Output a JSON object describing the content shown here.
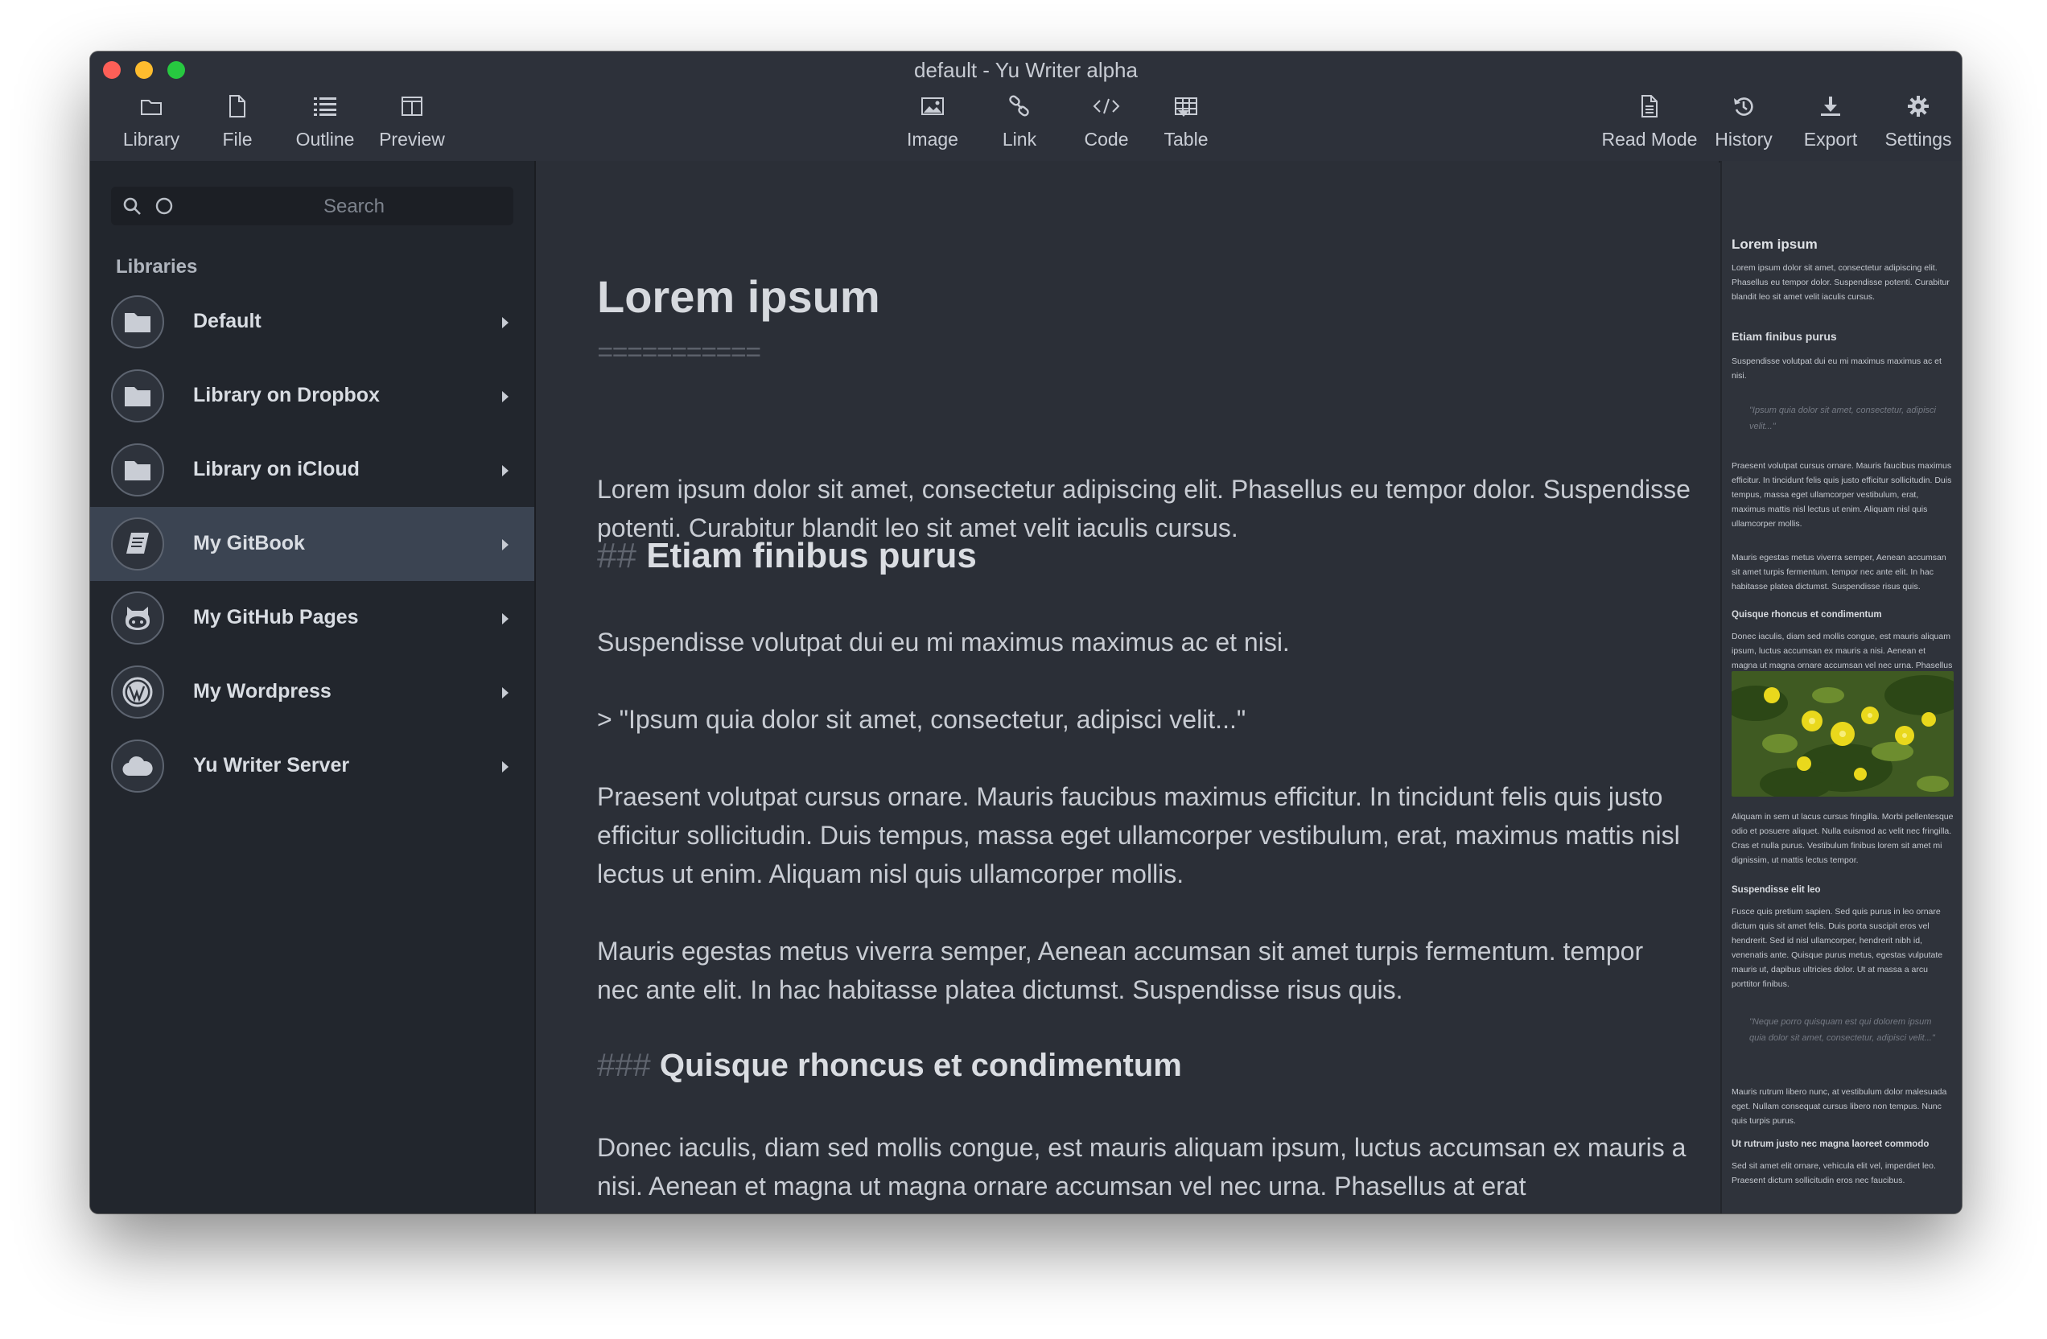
{
  "window": {
    "title": "default - Yu Writer alpha"
  },
  "toolbar": {
    "library": "Library",
    "file": "File",
    "outline": "Outline",
    "preview": "Preview",
    "image": "Image",
    "link": "Link",
    "code": "Code",
    "table": "Table",
    "read_mode": "Read Mode",
    "history": "History",
    "export": "Export",
    "settings": "Settings"
  },
  "sidebar": {
    "search_placeholder": "Search",
    "heading": "Libraries",
    "items": [
      {
        "label": "Default",
        "icon": "folder-icon"
      },
      {
        "label": "Library on Dropbox",
        "icon": "folder-icon"
      },
      {
        "label": "Library on iCloud",
        "icon": "folder-icon"
      },
      {
        "label": "My GitBook",
        "icon": "book-icon",
        "selected": true
      },
      {
        "label": "My GitHub Pages",
        "icon": "github-icon"
      },
      {
        "label": "My Wordpress",
        "icon": "wordpress-icon"
      },
      {
        "label": "Yu Writer Server",
        "icon": "cloud-icon"
      }
    ]
  },
  "editor": {
    "h1": "Lorem ipsum",
    "h1_underline": "===========",
    "p1": "Lorem ipsum dolor sit amet, consectetur adipiscing elit. Phasellus eu tempor dolor. Suspendisse potenti. Curabitur blandit leo sit amet velit iaculis cursus.",
    "h2_marker": "##",
    "h2": "Etiam finibus purus",
    "p2": "Suspendisse volutpat dui eu mi maximus maximus ac et nisi.",
    "quote": "> \"Ipsum quia dolor sit amet, consectetur, adipisci velit...\"",
    "p3": "Praesent volutpat cursus ornare. Mauris faucibus maximus efficitur. In tincidunt felis quis justo efficitur sollicitudin. Duis tempus, massa eget ullamcorper vestibulum, erat, maximus mattis nisl lectus ut enim. Aliquam nisl quis ullamcorper mollis.",
    "p4": "Mauris egestas metus viverra semper, Aenean accumsan sit amet turpis fermentum. tempor nec ante elit. In hac habitasse platea dictumst. Suspendisse risus quis.",
    "h3_marker": "###",
    "h3": "Quisque rhoncus et condimentum",
    "p5": "Donec iaculis, diam sed mollis congue, est mauris aliquam ipsum, luctus accumsan ex mauris a nisi. Aenean et magna ut magna ornare accumsan vel nec urna. Phasellus at erat"
  },
  "preview": {
    "h1": "Lorem ipsum",
    "p1": "Lorem ipsum dolor sit amet, consectetur adipiscing elit. Phasellus eu tempor dolor. Suspendisse potenti. Curabitur blandit leo sit amet velit iaculis cursus.",
    "h2": "Etiam finibus purus",
    "p2": "Suspendisse volutpat dui eu mi maximus maximus ac et nisi.",
    "quote1": "\"Ipsum quia dolor sit amet, consectetur, adipisci velit...\"",
    "p3": "Praesent volutpat cursus ornare. Mauris faucibus maximus efficitur. In tincidunt felis quis justo efficitur sollicitudin. Duis tempus, massa eget ullamcorper vestibulum, erat, maximus mattis nisl lectus ut enim. Aliquam nisl quis ullamcorper mollis.",
    "p4": "Mauris egestas metus viverra semper, Aenean accumsan sit amet turpis fermentum. tempor nec ante elit. In hac habitasse platea dictumst. Suspendisse risus quis.",
    "h3": "Quisque rhoncus et condimentum",
    "p5": "Donec iaculis, diam sed mollis congue, est mauris aliquam ipsum, luctus accumsan ex mauris a nisi. Aenean et magna ut magna ornare accumsan vel nec urna. Phasellus at erat ut risus aliquam lobortis.",
    "p6": "Aliquam in sem ut lacus cursus fringilla. Morbi pellentesque odio et posuere aliquet. Nulla euismod ac velit nec fringilla. Cras et nulla purus. Vestibulum finibus lorem sit amet mi dignissim, ut mattis lectus tempor.",
    "h4": "Suspendisse elit leo",
    "p7": "Fusce quis pretium sapien. Sed quis purus in leo ornare dictum quis sit amet felis. Duis porta suscipit eros vel hendrerit. Sed id nisl ullamcorper, hendrerit nibh id, venenatis ante. Quisque purus metus, egestas vulputate mauris ut, dapibus ultricies dolor. Ut at massa a arcu porttitor finibus.",
    "quote2": "\"Neque porro quisquam est qui dolorem ipsum quia dolor sit amet, consectetur, adipisci velit...\"",
    "p8": "Mauris rutrum libero nunc, at vestibulum dolor malesuada eget. Nullam consequat cursus libero non tempus. Nunc quis turpis purus.",
    "h5": "Ut rutrum justo nec magna laoreet commodo",
    "p9": "Sed sit amet elit ornare, vehicula elit vel, imperdiet leo. Praesent dictum sollicitudin eros nec faucibus."
  }
}
